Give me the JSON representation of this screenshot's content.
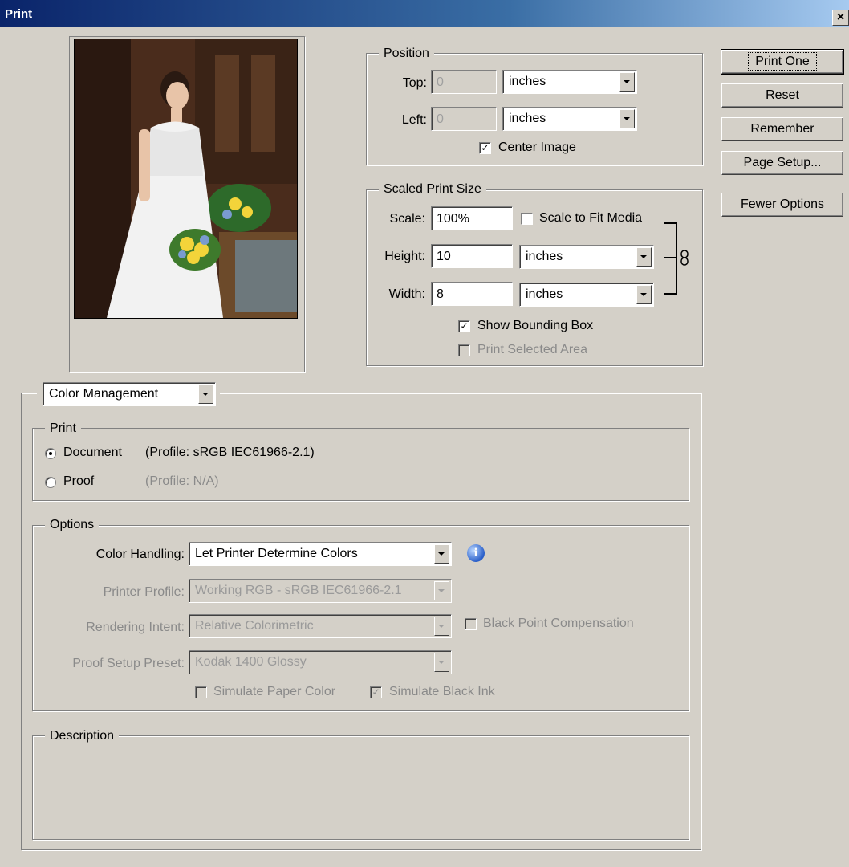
{
  "window": {
    "title": "Print",
    "close_glyph": "×"
  },
  "buttons": {
    "print_one": "Print One",
    "reset": "Reset",
    "remember": "Remember",
    "page_setup": "Page Setup...",
    "fewer_options": "Fewer Options"
  },
  "position": {
    "legend": "Position",
    "top_label": "Top:",
    "top_value": "0",
    "top_unit": "inches",
    "left_label": "Left:",
    "left_value": "0",
    "left_unit": "inches",
    "center_image_label": "Center Image",
    "center_image_checked": true
  },
  "scaled": {
    "legend": "Scaled Print Size",
    "scale_label": "Scale:",
    "scale_value": "100%",
    "scale_to_fit_label": "Scale to Fit Media",
    "height_label": "Height:",
    "height_value": "10",
    "height_unit": "inches",
    "width_label": "Width:",
    "width_value": "8",
    "width_unit": "inches",
    "show_bounding_box_label": "Show Bounding Box",
    "print_selected_area_label": "Print Selected Area"
  },
  "color_management": {
    "dropdown_value": "Color Management",
    "print_legend": "Print",
    "document_label": "Document",
    "document_profile": "(Profile: sRGB IEC61966-2.1)",
    "proof_label": "Proof",
    "proof_profile": "(Profile: N/A)",
    "options_legend": "Options",
    "color_handling_label": "Color Handling:",
    "color_handling_value": "Let Printer Determine Colors",
    "printer_profile_label": "Printer Profile:",
    "printer_profile_value": "Working RGB - sRGB IEC61966-2.1",
    "rendering_intent_label": "Rendering Intent:",
    "rendering_intent_value": "Relative Colorimetric",
    "black_point_label": "Black Point Compensation",
    "proof_setup_label": "Proof Setup Preset:",
    "proof_setup_value": "Kodak 1400 Glossy",
    "simulate_paper_label": "Simulate Paper Color",
    "simulate_black_label": "Simulate Black Ink",
    "description_legend": "Description"
  },
  "icons": {
    "info": "info-icon",
    "check_mark": "✓"
  }
}
